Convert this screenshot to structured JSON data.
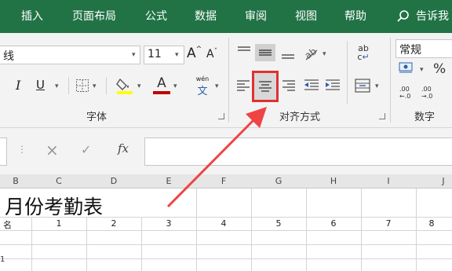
{
  "ribbon_tabs": [
    "插入",
    "页面布局",
    "公式",
    "数据",
    "审阅",
    "视图",
    "帮助"
  ],
  "tell_me": "告诉我",
  "font": {
    "name": "线",
    "size": "11",
    "increase_glyph": "A",
    "decrease_glyph": "A",
    "italic": "I",
    "underline": "U",
    "font_color_glyph": "A",
    "phonetic_top": "wén",
    "phonetic_bottom": "文",
    "group_label": "字体"
  },
  "alignment": {
    "wrap_glyph": "ab",
    "wrap_glyph2": "c",
    "group_label": "对齐方式"
  },
  "number": {
    "format": "常规",
    "percent": "%",
    "dec_inc": ".00 ←.0",
    "dec_dec": ".00 →.0",
    "group_label": "数字"
  },
  "formula_bar": {
    "cancel": "×",
    "enter": "✓",
    "fx": "fx"
  },
  "columns": [
    "B",
    "C",
    "D",
    "E",
    "F",
    "G",
    "H",
    "I",
    "J"
  ],
  "sheet": {
    "title": "月份考勤表",
    "name_label": "名",
    "days": [
      "1",
      "2",
      "3",
      "4",
      "5",
      "6",
      "7",
      "8"
    ]
  },
  "colors": {
    "ribbon_green": "#217346",
    "highlight_red": "#e03131",
    "arrow_red": "#ef4444",
    "font_color_bar": "#c00000",
    "fill_color_bar": "#ffff00"
  },
  "icons": [
    "search-icon",
    "dropdown-arrow-icon",
    "borders-icon",
    "fill-color-icon",
    "align-top-icon",
    "align-middle-icon",
    "align-bottom-icon",
    "orientation-icon",
    "align-left-icon",
    "align-center-icon",
    "align-right-icon",
    "decrease-indent-icon",
    "increase-indent-icon",
    "merge-center-icon",
    "wrap-text-icon",
    "accounting-format-icon",
    "dialog-launcher-icon",
    "annotation-arrow-icon"
  ]
}
